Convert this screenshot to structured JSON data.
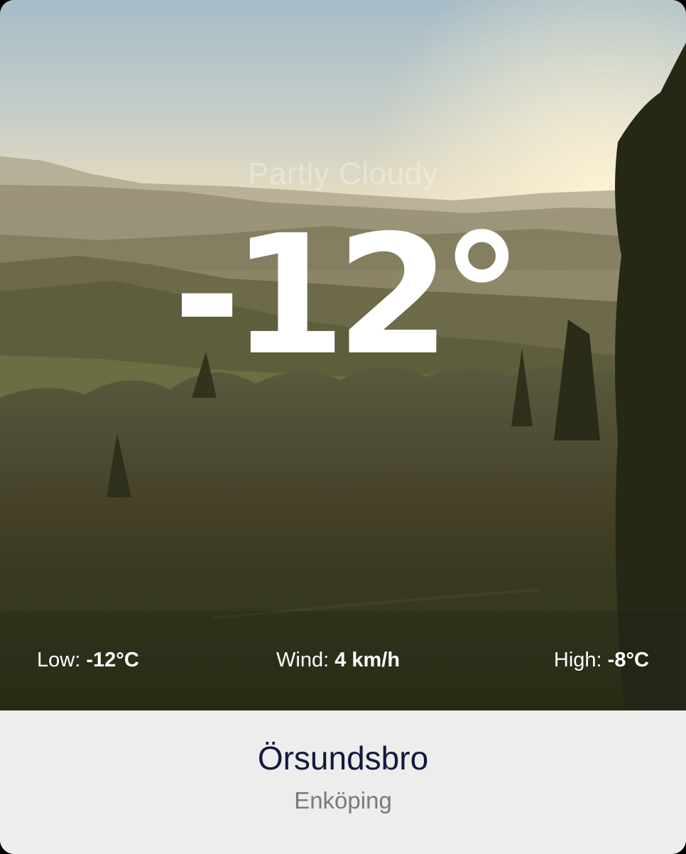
{
  "weather": {
    "condition": "Partly Cloudy",
    "temperature": "-12°",
    "low_label": "Low:",
    "low_value": "-12°C",
    "wind_label": "Wind:",
    "wind_value": "4 km/h",
    "high_label": "High:",
    "high_value": "-8°C"
  },
  "location": {
    "city": "Örsundsbro",
    "region": "Enköping"
  },
  "colors": {
    "footer_background": "#ededed",
    "city_text": "#14183a",
    "region_text": "#7a7a7a",
    "overlay_text": "#ffffff"
  }
}
